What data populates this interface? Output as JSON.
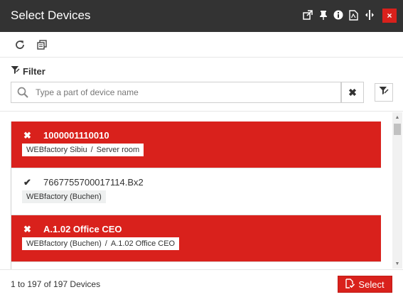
{
  "window": {
    "title": "Select Devices",
    "close_label": "×"
  },
  "title_icons": [
    "popout-icon",
    "pin-icon",
    "info-icon",
    "pdf-icon",
    "resize-icon"
  ],
  "toolbar": {
    "icons": [
      "refresh-icon",
      "copy-icon"
    ]
  },
  "filter": {
    "label": "Filter",
    "search_placeholder": "Type a part of device name",
    "search_value": "",
    "clear_label": "✖"
  },
  "devices": [
    {
      "name": "1000001110010",
      "selected": true,
      "path": [
        "WEBfactory Sibiu",
        "Server room"
      ]
    },
    {
      "name": "7667755700017114.Bx2",
      "selected": false,
      "path": [
        "WEBfactory (Buchen)"
      ]
    },
    {
      "name": "A.1.02 Office CEO",
      "selected": true,
      "path": [
        "WEBfactory (Buchen)",
        "A.1.02 Office CEO"
      ]
    }
  ],
  "footer": {
    "count_text": "1 to 197 of 197 Devices",
    "select_label": "Select"
  },
  "colors": {
    "titlebar": "#333333",
    "accent": "#d9211c"
  }
}
